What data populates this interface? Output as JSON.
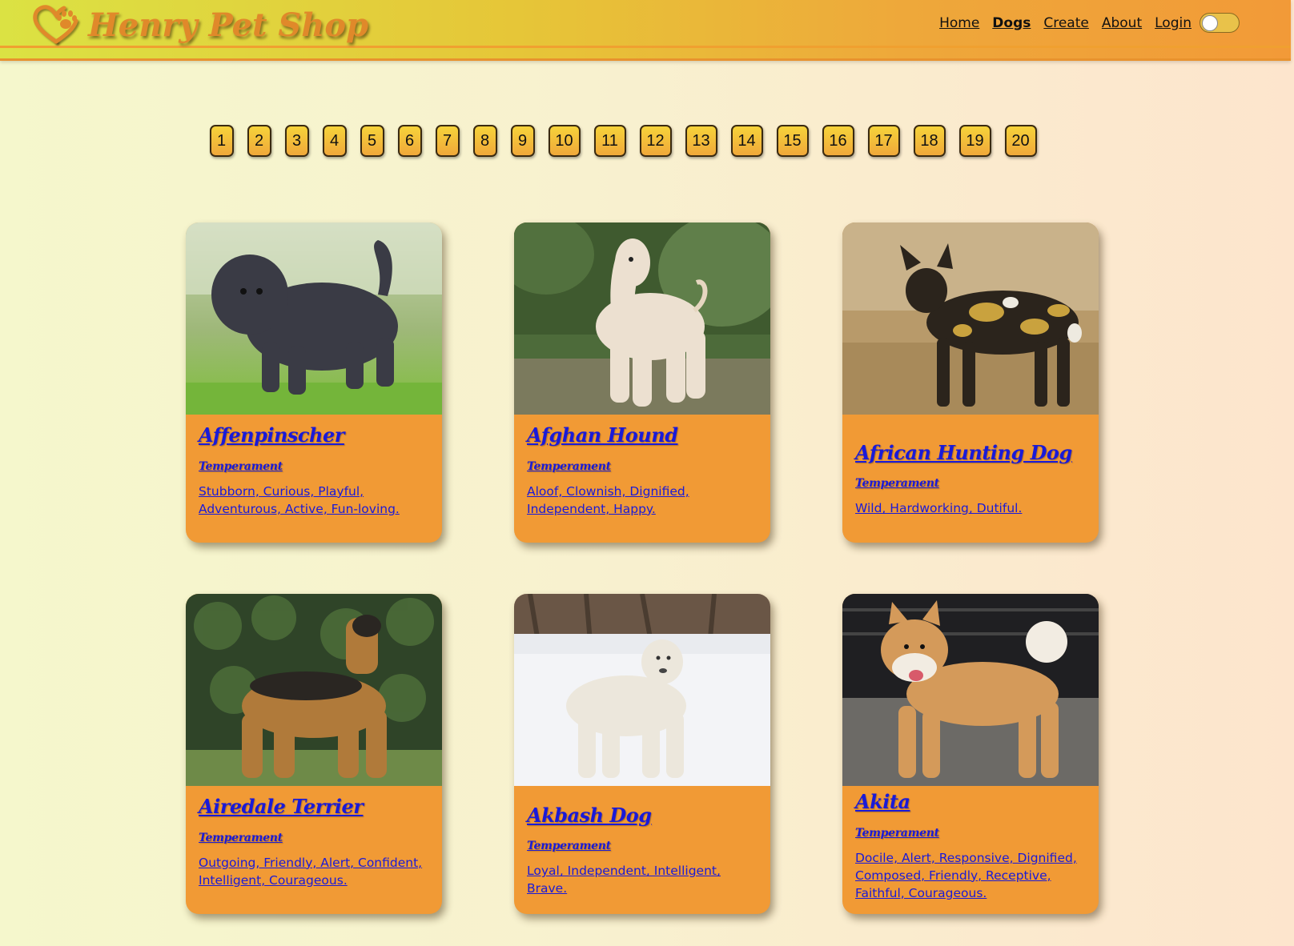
{
  "header": {
    "brand_title": "Henry Pet Shop",
    "logo_icon": "heart-paw-icon",
    "nav": [
      {
        "label": "Home",
        "active": false
      },
      {
        "label": "Dogs",
        "active": true
      },
      {
        "label": "Create",
        "active": false
      },
      {
        "label": "About",
        "active": false
      },
      {
        "label": "Login",
        "active": false
      }
    ],
    "theme_toggle": {
      "on": false
    }
  },
  "pagination": {
    "pages": [
      "1",
      "2",
      "3",
      "4",
      "5",
      "6",
      "7",
      "8",
      "9",
      "10",
      "11",
      "12",
      "13",
      "14",
      "15",
      "16",
      "17",
      "18",
      "19",
      "20"
    ]
  },
  "cards": [
    {
      "name": "Affenpinscher",
      "temperament_label": "Temperament",
      "temperament": "Stubborn, Curious, Playful, Adventurous, Active, Fun-loving.",
      "image_subject": "black shaggy dog on grass"
    },
    {
      "name": "Afghan Hound",
      "temperament_label": "Temperament",
      "temperament": "Aloof, Clownish, Dignified, Independent, Happy.",
      "image_subject": "cream long-haired hound in woods"
    },
    {
      "name": "African Hunting Dog",
      "temperament_label": "Temperament",
      "temperament": "Wild, Hardworking, Dutiful.",
      "image_subject": "mottled wild dog in dry grass"
    },
    {
      "name": "Airedale Terrier",
      "temperament_label": "Temperament",
      "temperament": "Outgoing, Friendly, Alert, Confident, Intelligent, Courageous.",
      "image_subject": "tan and black terrier by hedge"
    },
    {
      "name": "Akbash Dog",
      "temperament_label": "Temperament",
      "temperament": "Loyal, Independent, Intelligent, Brave.",
      "image_subject": "white dog in snow"
    },
    {
      "name": "Akita",
      "temperament_label": "Temperament",
      "temperament": "Docile, Alert, Responsive, Dignified, Composed, Friendly, Receptive, Faithful, Courageous.",
      "image_subject": "red and white akita on pavement"
    }
  ]
}
